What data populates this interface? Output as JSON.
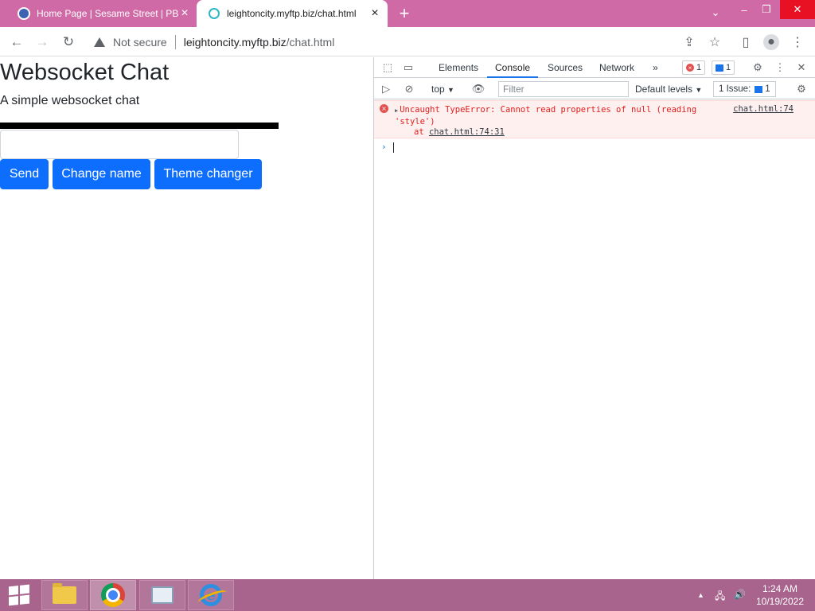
{
  "browser": {
    "tabs": [
      {
        "title": "Home Page | Sesame Street | PBS",
        "icon": "pbs-favicon",
        "active": false
      },
      {
        "title": "leightoncity.myftp.biz/chat.html",
        "icon": "loading-favicon",
        "active": true
      }
    ],
    "new_tab_symbol": "+",
    "address_bar": {
      "security_label": "Not secure",
      "url_host": "leightoncity.myftp.biz",
      "url_path": "/chat.html"
    }
  },
  "page": {
    "title": "Websocket Chat",
    "subtitle": "A simple websocket chat",
    "message_input_value": "",
    "buttons": {
      "send": "Send",
      "change_name": "Change name",
      "theme_changer": "Theme changer"
    },
    "accent_color": "#0d6efd"
  },
  "devtools": {
    "tabs": [
      "Elements",
      "Console",
      "Sources",
      "Network"
    ],
    "active_tab": "Console",
    "more_tabs_symbol": "»",
    "error_count": "1",
    "message_count": "1",
    "context": "top",
    "filter_placeholder": "Filter",
    "levels_label": "Default levels",
    "issues_label": "1 Issue:",
    "issues_count": "1",
    "console": {
      "error_message": "Uncaught TypeError: Cannot read properties of null (reading 'style')",
      "error_source": "chat.html:74",
      "stack_prefix": "at ",
      "stack_link": "chat.html:74:31",
      "prompt_symbol": "›"
    }
  },
  "taskbar": {
    "apps": [
      "file-explorer",
      "chrome",
      "performance-monitor",
      "internet-explorer"
    ],
    "clock_time": "1:24 AM",
    "clock_date": "10/19/2022"
  },
  "colors": {
    "titlebar": "#d06aa6",
    "taskbar": "#a8648d",
    "error_text": "#e21c1c",
    "error_bg": "#fff0f0"
  }
}
